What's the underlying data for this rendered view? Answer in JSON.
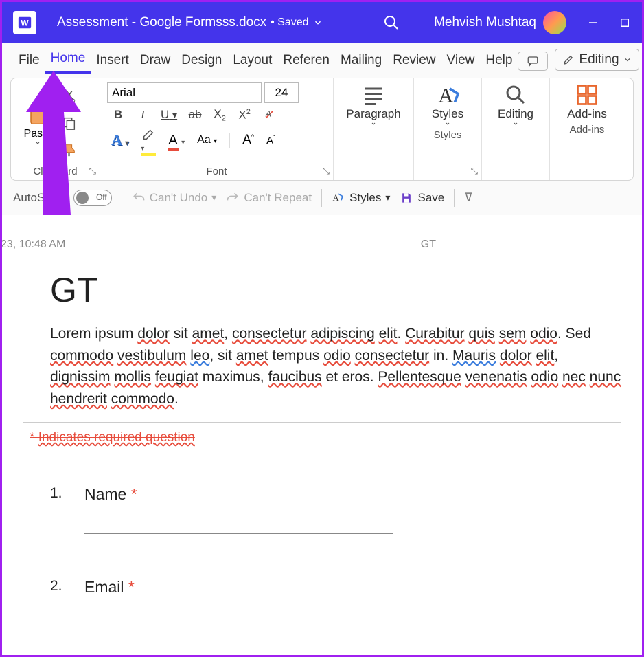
{
  "titlebar": {
    "app_icon_label": "W",
    "doc_title": "Assessment - Google Formsss.docx",
    "save_status": "• Saved",
    "user_name": "Mehvish Mushtaq"
  },
  "menu": {
    "file": "File",
    "home": "Home",
    "insert": "Insert",
    "draw": "Draw",
    "design": "Design",
    "layout": "Layout",
    "references": "Referen",
    "mailings": "Mailing",
    "review": "Review",
    "view": "View",
    "help": "Help",
    "editing": "Editing"
  },
  "ribbon": {
    "clipboard": {
      "paste": "Paste",
      "label": "Clipboard"
    },
    "font": {
      "name": "Arial",
      "size": "24",
      "bold": "B",
      "italic": "I",
      "underline": "U",
      "strike": "ab",
      "subscript": "X₂",
      "superscript": "X²",
      "text_effects": "A",
      "highlight": "✎",
      "font_color": "A",
      "change_case": "Aa",
      "grow": "A^",
      "shrink": "Aˇ",
      "label": "Font"
    },
    "paragraph": {
      "label": "Paragraph"
    },
    "styles": {
      "label": "Styles"
    },
    "editing": {
      "label": "Editing"
    },
    "addins": {
      "label": "Add-ins"
    }
  },
  "qat": {
    "autosave": "AutoSave",
    "autosave_state": "Off",
    "undo": "Can't Undo",
    "redo": "Can't Repeat",
    "styles": "Styles",
    "save": "Save"
  },
  "document": {
    "header_left": "23, 10:48 AM",
    "header_right": "GT",
    "title": "GT",
    "paragraph": "Lorem ipsum dolor sit amet, consectetur adipiscing elit. Curabitur quis sem odio. Sed commodo vestibulum leo, sit amet tempus odio consectetur in. Mauris dolor elit, dignissim mollis feugiat maximus, faucibus et eros. Pellentesque venenatis odio nec nunc hendrerit commodo.",
    "required_note_prefix": "* ",
    "required_note": "Indicates required question",
    "q1_num": "1.",
    "q1_label": "Name",
    "q2_num": "2.",
    "q2_label": "Email",
    "star": "*"
  }
}
